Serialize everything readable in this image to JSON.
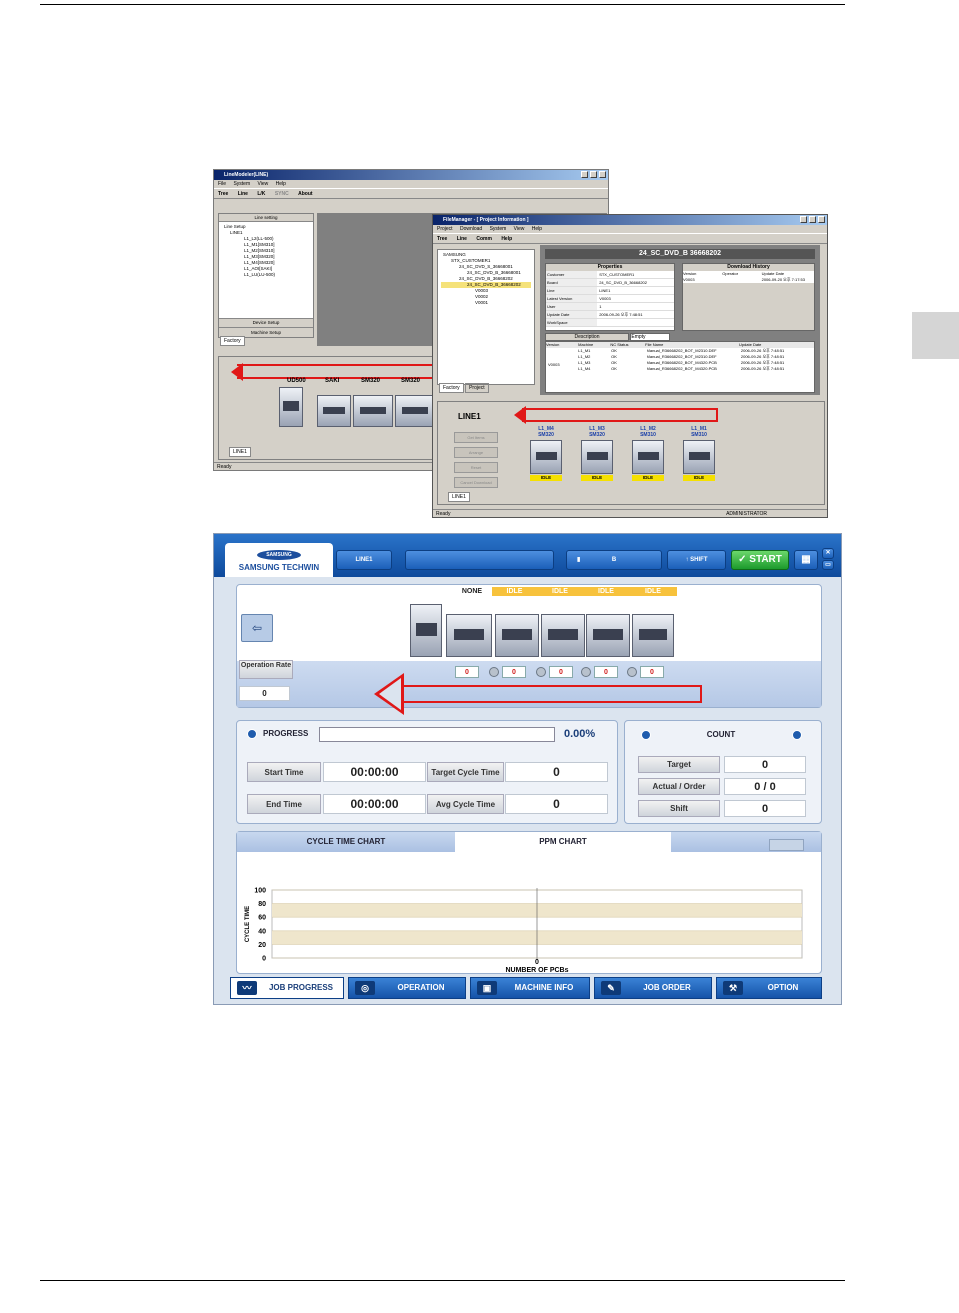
{
  "screenshot1": {
    "title": "LineModeler(LINE)",
    "menu": [
      "File",
      "System",
      "View",
      "Help"
    ],
    "toolbar": [
      "Tree",
      "Line",
      "L/K",
      "SYNC",
      "About"
    ],
    "panel_header": "Line setting",
    "tree": [
      "Line Setup",
      "LINE1",
      "L1_L2(LL-500)",
      "L1_M1[SM310]",
      "L1_M2[SM310]",
      "L1_M3[SM320]",
      "L1_M4[SM320]",
      "L1_AOI[SAKI]",
      "L1_LU(LU-500)"
    ],
    "device_setup": "Device Setup",
    "machine_setup": "Machine Setup",
    "factory_tab": "Factory",
    "machine_labels": [
      "UD500",
      "SAKI",
      "SM320",
      "SM320"
    ],
    "line_tab": "LINE1",
    "status": "Ready"
  },
  "screenshot2": {
    "title": "FileManager - [ Project Information ]",
    "menu": [
      "Project",
      "Download",
      "System",
      "View",
      "Help"
    ],
    "toolbar": [
      "Tree",
      "Line",
      "Comm",
      "Help"
    ],
    "tree": [
      "SAMSUNG",
      "STX_CUSTOMER1",
      "24_SC_DVD_S_36668001",
      "24_SC_DVD_B_36668001",
      "24_SC_DVD_B_36668202",
      "24_SC_DVD_B_36668202",
      "V0003",
      "V0002",
      "V0001"
    ],
    "banner": "24_SC_DVD_B 36668202",
    "properties_header": "Properties",
    "download_header": "Download History",
    "properties": [
      [
        "Customer",
        "STX_CUSTOMER1"
      ],
      [
        "Board",
        "24_SC_DVD_B_36668202"
      ],
      [
        "Line",
        "LINE1"
      ],
      [
        "Latest Version",
        "V0003"
      ],
      [
        "User",
        "1"
      ],
      [
        "Update Date",
        "2006-09-26 오후 7:48:51"
      ],
      [
        "WorkSpace",
        ""
      ]
    ],
    "download_cols": [
      "Version",
      "Operator",
      "Update Date"
    ],
    "download_row": [
      "V0003",
      "",
      "2006-09-20 오후 7:17:53"
    ],
    "description_tab": "Description",
    "empty_tab": "Empty",
    "table_cols": [
      "Version",
      "Machine",
      "NC Status",
      "File Name",
      "Update Date"
    ],
    "table_version": "V0003",
    "table_rows": [
      [
        "L1_M1",
        "OK",
        "Manual_R36668202_BOT_M2310.DEF",
        "2006-09-26 오후 7:48:51"
      ],
      [
        "L1_M2",
        "OK",
        "Manual_R36668202_BOT_M2310.DEF",
        "2006-09-26 오후 7:48:51"
      ],
      [
        "L1_M3",
        "OK",
        "Manual_R36668202_BOT_M4320.PCB",
        "2006-09-26 오후 7:48:51"
      ],
      [
        "L1_M4",
        "OK",
        "Manual_R36668202_BOT_M4320.PCB",
        "2006-09-26 오후 7:48:51"
      ]
    ],
    "left_tabs": [
      "Factory",
      "Project"
    ],
    "line_name": "LINE1",
    "buttons": [
      "Get Items",
      "Arrange",
      "Reset",
      "Cancel Download"
    ],
    "machines": [
      [
        "L1_M4",
        "SM320"
      ],
      [
        "L1_M3",
        "SM320"
      ],
      [
        "L1_M2",
        "SM310"
      ],
      [
        "L1_M1",
        "SM310"
      ]
    ],
    "machine_state": "IDLE",
    "line_tab": "LINE1",
    "status": "Ready",
    "status_user": "ADMINISTRATOR"
  },
  "samsung": {
    "logo": "SAMSUNG",
    "brand": "SAMSUNG TECHWIN",
    "line_button": "LINE1",
    "b_button": "B",
    "shift_button": "SHIFT",
    "start_button": "START",
    "status_cells": [
      "NONE",
      "IDLE",
      "IDLE",
      "IDLE",
      "IDLE"
    ],
    "operation_rate_label": "Operation Rate",
    "operation_rate_value": "0",
    "machine_rates": [
      "0",
      "0",
      "0",
      "0",
      "0"
    ],
    "progress_label": "PROGRESS",
    "progress_value": "0.00%",
    "progress_fraction": 0,
    "start_time_label": "Start Time",
    "start_time_value": "00:00:00",
    "end_time_label": "End Time",
    "end_time_value": "00:00:00",
    "target_cycle_label": "Target Cycle Time",
    "target_cycle_value": "0",
    "avg_cycle_label": "Avg Cycle Time",
    "avg_cycle_value": "0",
    "count_label": "COUNT",
    "target_label": "Target",
    "target_value": "0",
    "actual_label": "Actual / Order",
    "actual_value": "0 / 0",
    "shift_label": "Shift",
    "shift_value": "0",
    "chart_tab_cycle": "CYCLE TIME CHART",
    "chart_tab_ppm": "PPM CHART",
    "bottom_tabs": [
      "JOB PROGRESS",
      "OPERATION",
      "MACHINE INFO",
      "JOB ORDER",
      "OPTION"
    ]
  },
  "chart_data": {
    "type": "line",
    "title": "",
    "xlabel": "NUMBER OF PCBs",
    "ylabel": "CYCLE TIME",
    "yticks": [
      "100",
      "80",
      "60",
      "40",
      "20",
      "0"
    ],
    "ylim": [
      0,
      100
    ],
    "xticks": [
      "0"
    ],
    "series": [
      {
        "values": []
      }
    ]
  }
}
